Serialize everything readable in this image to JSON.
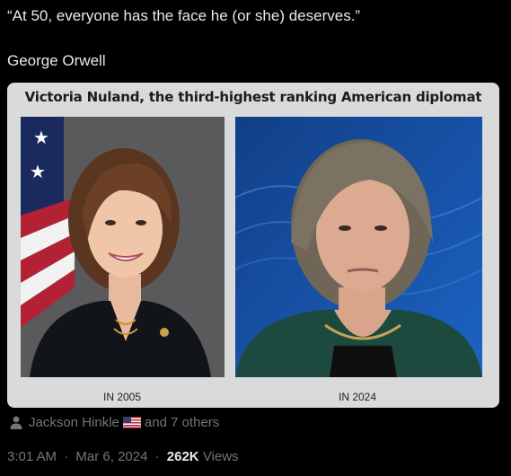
{
  "post": {
    "quote": "“At 50, everyone has the face he (or she) deserves.”",
    "author": "George Orwell"
  },
  "image_card": {
    "title": "Victoria Nuland,  the third-highest ranking American diplomat",
    "left_caption": "IN 2005",
    "right_caption": "IN 2024"
  },
  "social_context": {
    "user": "Jackson Hinkle",
    "others": "and 7 others",
    "icons": [
      "person-icon",
      "us-flag-icon"
    ]
  },
  "meta": {
    "time": "3:01 AM",
    "date": "Mar 6, 2024",
    "views_count": "262K",
    "views_label": "Views",
    "separator": "·"
  },
  "colors": {
    "background": "#000000",
    "primary_text": "#e7e9ea",
    "secondary_text": "#71767b",
    "card_background": "#d9dadb"
  }
}
